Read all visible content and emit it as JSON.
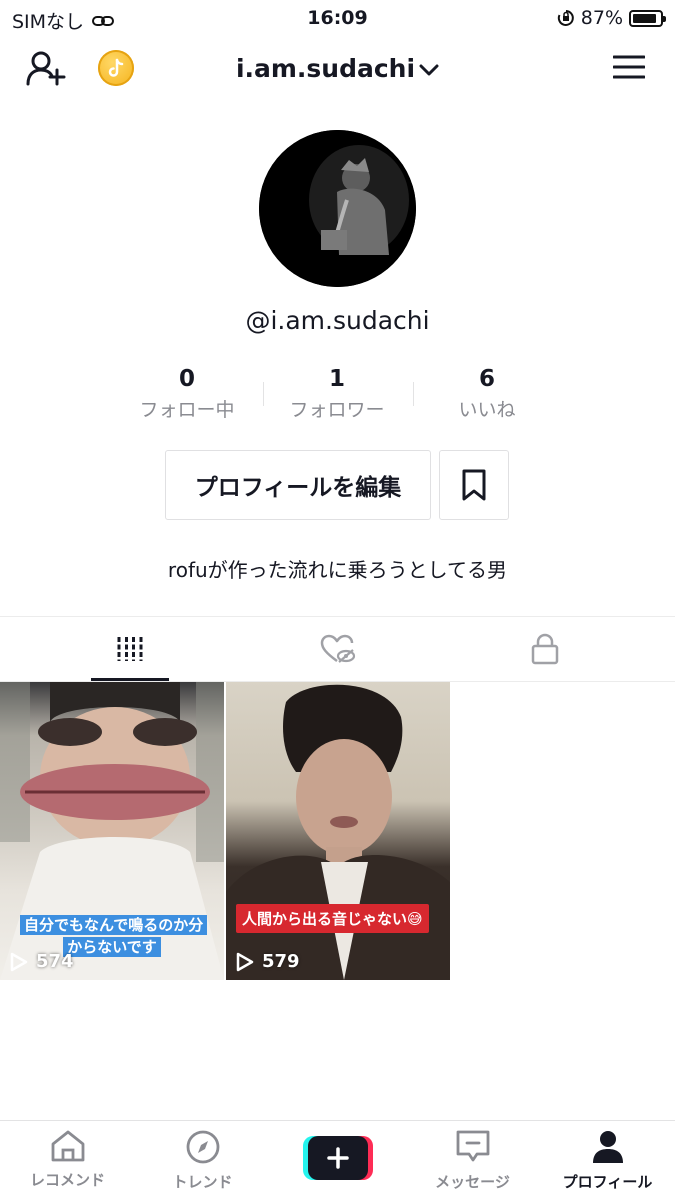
{
  "status_bar": {
    "carrier": "SIMなし",
    "time": "16:09",
    "battery_percent": "87%",
    "battery_level": 0.87
  },
  "header": {
    "username": "i.am.sudachi"
  },
  "profile": {
    "handle": "@i.am.sudachi",
    "stats": [
      {
        "value": "0",
        "label": "フォロー中"
      },
      {
        "value": "1",
        "label": "フォロワー"
      },
      {
        "value": "6",
        "label": "いいね"
      }
    ],
    "edit_button": "プロフィールを編集",
    "bio": "rofuが作った流れに乗ろうとしてる男"
  },
  "tabs": [
    {
      "icon": "grid-icon",
      "active": true
    },
    {
      "icon": "liked-hidden-icon",
      "active": false
    },
    {
      "icon": "lock-icon",
      "active": false
    }
  ],
  "videos": [
    {
      "caption": "自分でもなんで鳴るのか分からないです",
      "plays": "574",
      "caption_color": "#3d8fe0"
    },
    {
      "caption": "人間から出る音じゃない😅",
      "plays": "579",
      "caption_color": "#d7282f"
    }
  ],
  "bottom_nav": [
    {
      "icon": "home-icon",
      "label": "レコメンド"
    },
    {
      "icon": "compass-icon",
      "label": "トレンド"
    },
    {
      "icon": "create-plus-icon",
      "label": ""
    },
    {
      "icon": "message-icon",
      "label": "メッセージ"
    },
    {
      "icon": "profile-icon",
      "label": "プロフィール",
      "active": true
    }
  ],
  "colors": {
    "text": "#161823",
    "muted": "#8a8b91",
    "accent_cyan": "#25f4ee",
    "accent_red": "#fe2c55"
  }
}
